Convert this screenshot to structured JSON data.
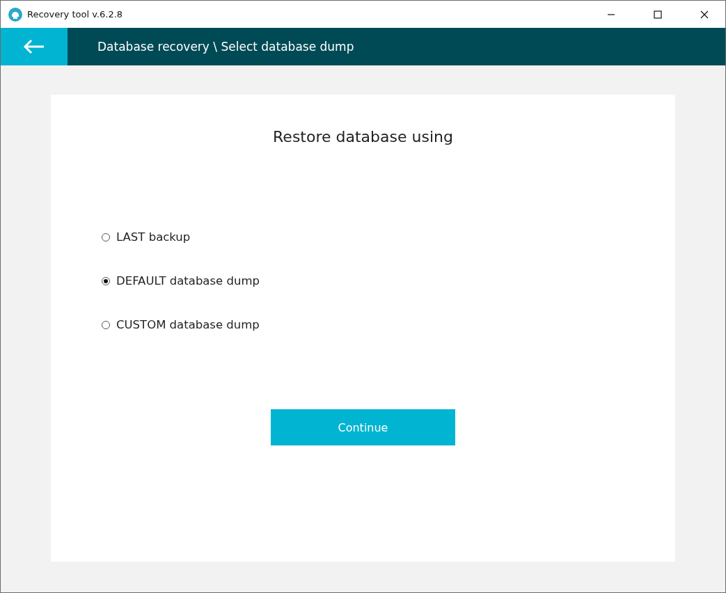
{
  "window": {
    "title": "Recovery tool v.6.2.8"
  },
  "header": {
    "breadcrumb": "Database recovery \\ Select database dump"
  },
  "card": {
    "heading": "Restore database using",
    "options": [
      {
        "label": "LAST backup",
        "selected": false
      },
      {
        "label": "DEFAULT database dump",
        "selected": true
      },
      {
        "label": "CUSTOM database dump",
        "selected": false
      }
    ],
    "button": "Continue"
  }
}
